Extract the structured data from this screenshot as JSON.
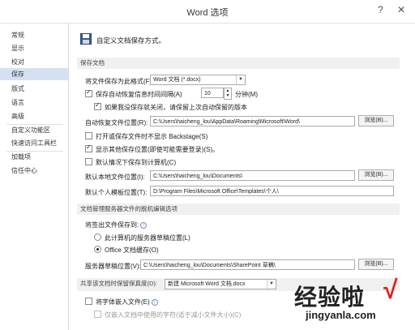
{
  "window": {
    "title": "Word 选项",
    "help": "?",
    "close": "✕"
  },
  "sidebar": {
    "items": [
      {
        "label": "常规"
      },
      {
        "label": "显示"
      },
      {
        "label": "校对"
      },
      {
        "label": "保存"
      },
      {
        "label": "版式"
      },
      {
        "label": "语言"
      },
      {
        "label": "高级"
      },
      {
        "label": "自定义功能区"
      },
      {
        "label": "快速访问工具栏"
      },
      {
        "label": "加载项"
      },
      {
        "label": "信任中心"
      }
    ]
  },
  "header": {
    "text": "自定义文档保存方式。"
  },
  "save_docs": {
    "section": "保存文档",
    "format_label": "将文件保存为此格式(F):",
    "format_value": "Word 文档 (*.docx)",
    "autorecover_label": "保存自动恢复信息时间间隔(A)",
    "autorecover_minutes": "10",
    "minutes_unit": "分钟(M)",
    "keep_last_label": "如果我没保存就关闭，请保留上次自动保留的版本",
    "autorecover_loc_label": "自动恢复文件位置(R):",
    "autorecover_loc_value": "C:\\Users\\haicheng_lou\\AppData\\Roaming\\Microsoft\\Word\\",
    "browse": "浏览(B)...",
    "no_backstage_label": "打开或保存文件时不显示 Backstage(S)",
    "show_other_label": "显示其他保存位置(即使可能需要登录)(S)。",
    "default_computer_label": "默认情况下保存到计算机(C)",
    "local_file_loc_label": "默认本地文件位置(I):",
    "local_file_loc_value": "C:\\Users\\haicheng_lou\\Documents\\",
    "personal_template_label": "默认个人模板位置(T):",
    "personal_template_value": "D:\\Program Files\\Microsoft Office\\Templates\\个人\\"
  },
  "offline": {
    "section": "文档管理服务器文件的脱机编辑选项",
    "save_to_label": "将签出文件保存到:",
    "opt_server_drafts": "此计算机的服务器草稿位置(L)",
    "opt_office_cache": "Office 文档缓存(O)",
    "drafts_loc_label": "服务器草稿位置(V):",
    "drafts_loc_value": "C:\\Users\\haicheng_lou\\Documents\\SharePoint 草稿\\"
  },
  "fidelity": {
    "section_label": "共享该文档时保留保真度(D):",
    "doc_value": "新建 Microsoft Word 文档.docx",
    "embed_fonts_label": "将字体嵌入文件(E)",
    "embed_subset_label": "仅嵌入文档中使用的字符(适于减小文件大小)(C)"
  },
  "watermark": {
    "text": "经验啦",
    "check": "√",
    "url": "jingyanla.com"
  },
  "colors": {
    "accent": "#d5e1f2",
    "watermark": "#222222"
  }
}
